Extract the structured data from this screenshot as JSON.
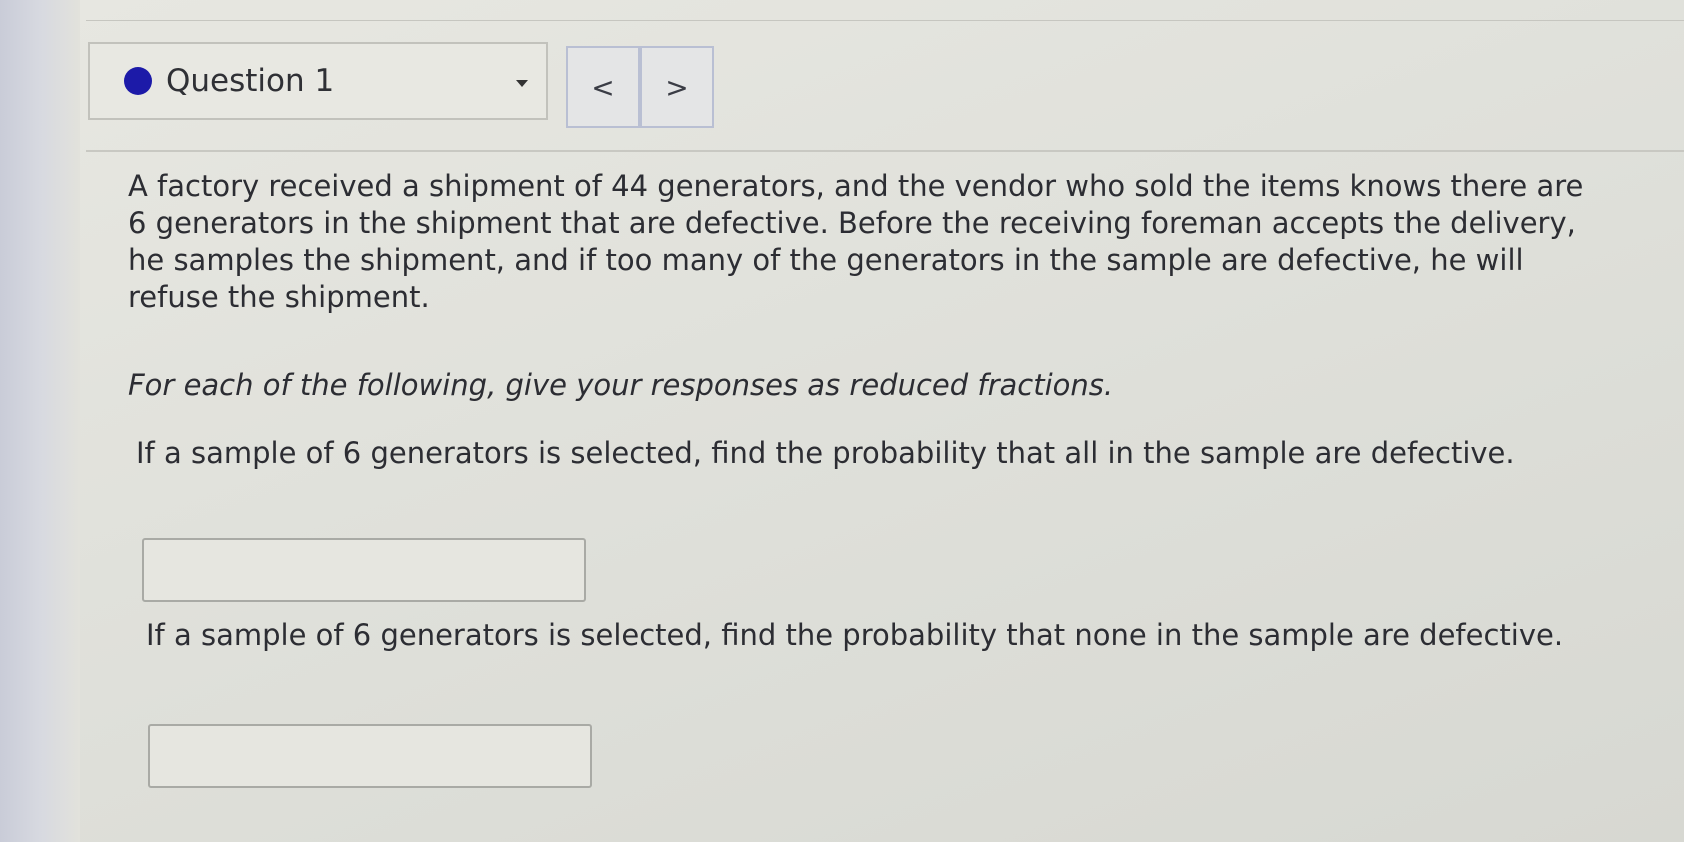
{
  "question_nav": {
    "label": "Question 1",
    "prev_symbol": "<",
    "next_symbol": ">",
    "status_color": "#1c1aa8"
  },
  "problem": {
    "text": "A factory received a shipment of 44 generators, and the vendor who sold the items knows there are 6 generators in the shipment that are defective. Before the receiving foreman accepts the delivery, he samples the shipment, and if too many of the generators in the sample are defective, he will refuse the shipment.",
    "instructions": "For each of the following, give your responses as reduced fractions."
  },
  "parts": [
    {
      "prompt": "If a sample of 6 generators is selected, find the probability that all in the sample are defective.",
      "answer_value": ""
    },
    {
      "prompt": "If a sample of 6 generators is selected, find the probability that none in the sample are defective.",
      "answer_value": ""
    }
  ]
}
